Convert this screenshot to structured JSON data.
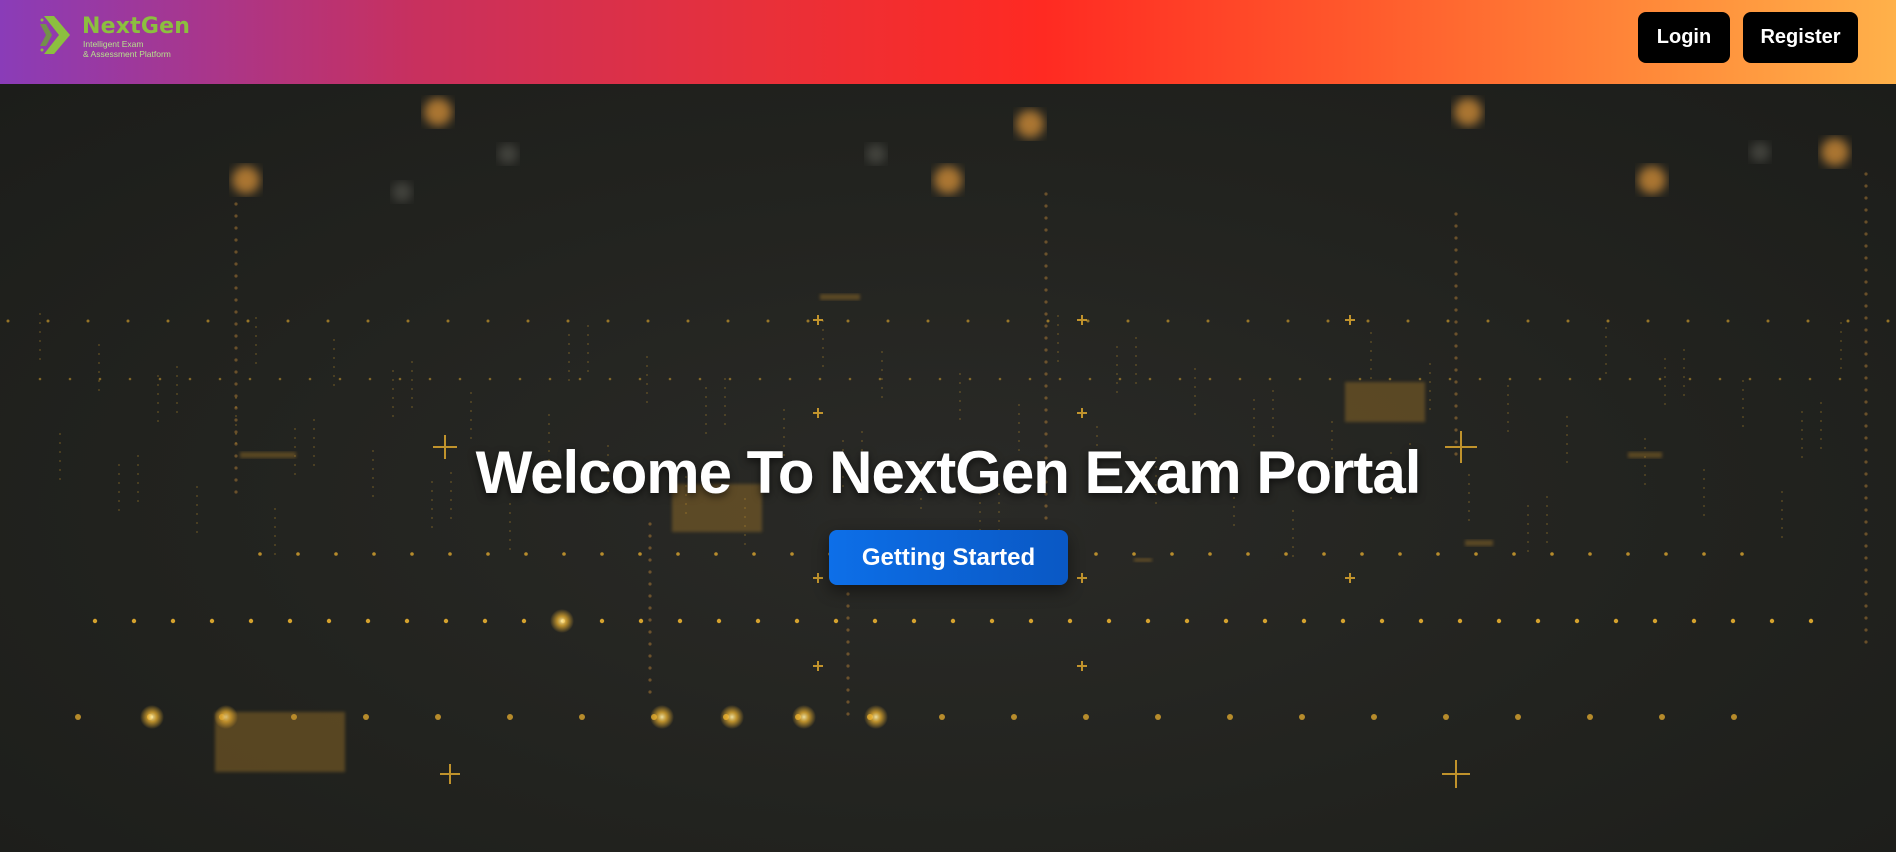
{
  "brand": {
    "name": "NextGen",
    "tagline": "Intelligent Exam\n& Assessment  Platform",
    "logo_icon": "chevron-right-icon"
  },
  "nav": {
    "login_label": "Login",
    "register_label": "Register"
  },
  "hero": {
    "title": "Welcome To NextGen Exam Portal",
    "cta_label": "Getting Started"
  },
  "colors": {
    "header_gradient": [
      "#8a3cb8",
      "#ff2a22",
      "#ffb14a"
    ],
    "button_dark": "#000000",
    "cta_blue": "#0d6fe8",
    "brand_green": "#8cbf3f",
    "background": "#222321",
    "particle_gold": "#f5b830"
  }
}
